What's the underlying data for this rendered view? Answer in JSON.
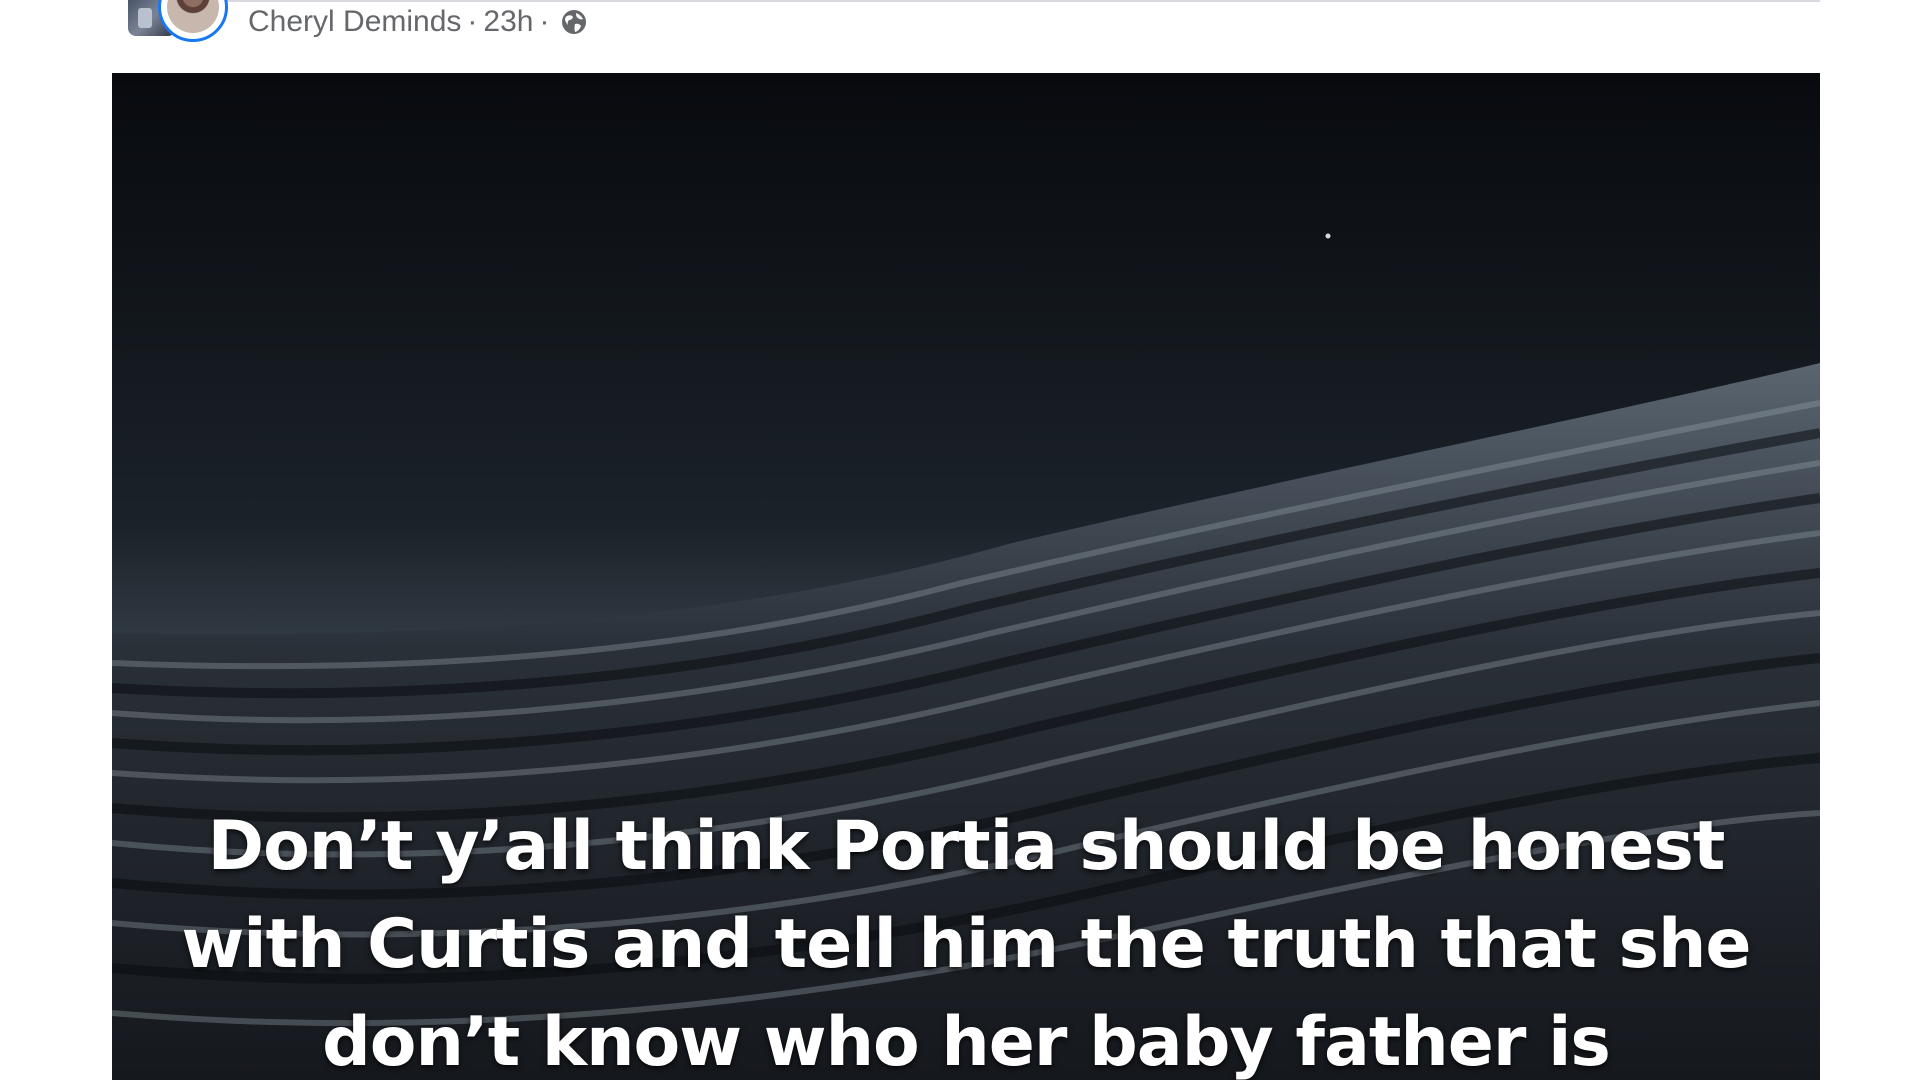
{
  "post": {
    "author": "Cheryl Deminds",
    "separator": "·",
    "time": "23h",
    "audience_icon": "globe-icon",
    "image_caption": "Don’t y’all think Portia should be honest with Curtis and tell him the truth that she don’t know who her baby father is"
  },
  "colors": {
    "avatar_ring": "#1877f2",
    "meta_text": "#65676b",
    "caption_text": "#ffffff"
  }
}
